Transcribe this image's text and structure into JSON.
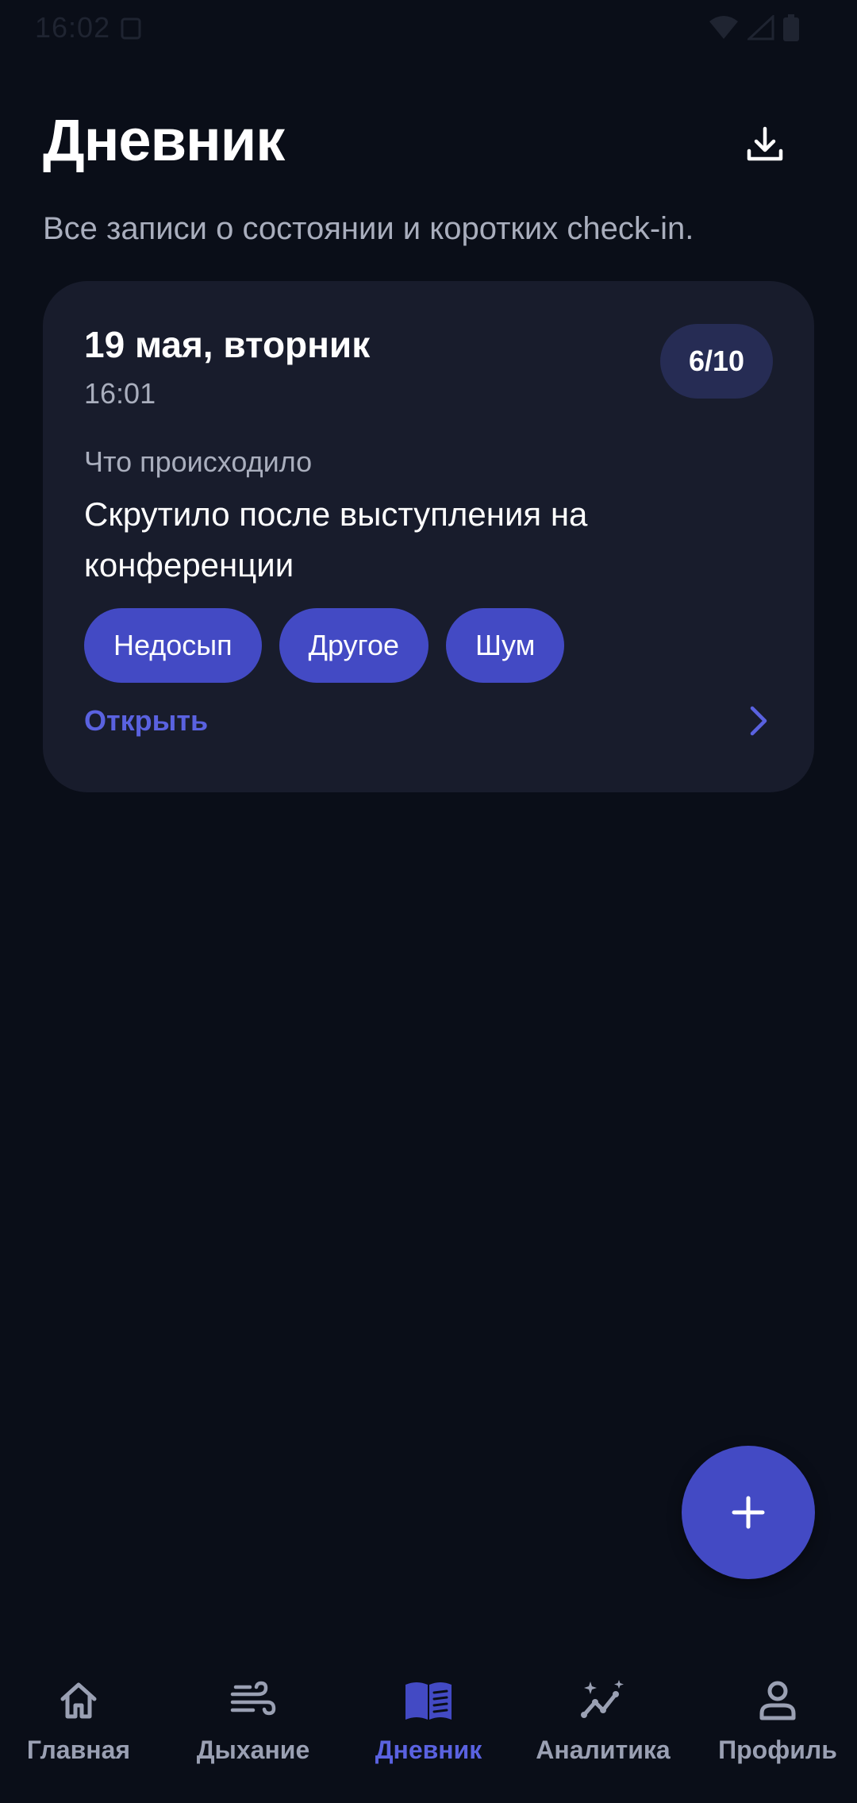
{
  "status_bar": {
    "time": "16:02"
  },
  "header": {
    "title": "Дневник",
    "subtitle": "Все записи о состоянии и коротких check-in."
  },
  "entries": [
    {
      "date": "19 мая, вторник",
      "time": "16:01",
      "score": "6/10",
      "section_label": "Что происходило",
      "text": "Скрутило после выступления на конференции",
      "tags": [
        "Недосып",
        "Другое",
        "Шум"
      ],
      "open_label": "Открыть"
    }
  ],
  "bottom_nav": {
    "items": [
      {
        "label": "Главная",
        "icon": "home-icon"
      },
      {
        "label": "Дыхание",
        "icon": "wind-icon"
      },
      {
        "label": "Дневник",
        "icon": "book-icon",
        "active": true
      },
      {
        "label": "Аналитика",
        "icon": "sparkle-chart-icon"
      },
      {
        "label": "Профиль",
        "icon": "person-icon"
      }
    ]
  },
  "colors": {
    "background": "#0a0e18",
    "card": "#181c2c",
    "accent": "#434ac4",
    "accent_text": "#5a62e0",
    "score_badge": "#262c54",
    "muted_text": "#a9aebd",
    "nav_inactive": "#9aa0b3"
  }
}
